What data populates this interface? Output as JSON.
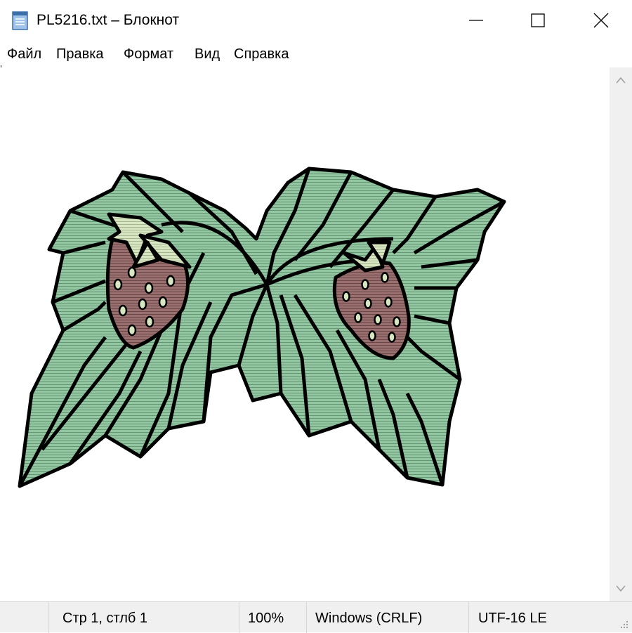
{
  "window": {
    "title": "PL5216.txt – Блокнот",
    "app_icon": "notepad-icon",
    "controls": [
      "minimize-icon",
      "maximize-icon",
      "close-icon"
    ]
  },
  "menu": {
    "items": [
      {
        "label": "Файл"
      },
      {
        "label": "Правка"
      },
      {
        "label": "Формат"
      },
      {
        "label": "Вид"
      },
      {
        "label": "Справка"
      }
    ]
  },
  "document": {
    "content_type": "image",
    "colors": {
      "leaf": "#93c7a2",
      "berry": "#9a6f6f",
      "light": "#d8e6c2",
      "outline": "#000000"
    }
  },
  "scrollbar": {
    "up_icon": "chevron-up-icon",
    "down_icon": "chevron-down-icon"
  },
  "statusbar": {
    "position": "Стр 1, стлб 1",
    "zoom": "100%",
    "line_endings": "Windows (CRLF)",
    "encoding": "UTF-16 LE"
  }
}
